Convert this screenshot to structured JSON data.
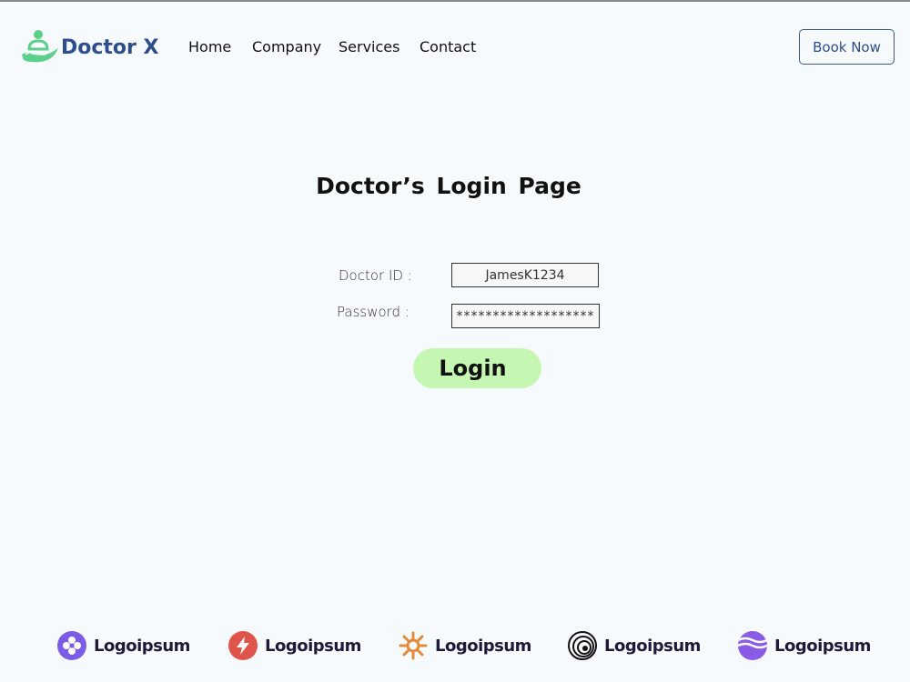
{
  "brand": {
    "name": "Doctor X",
    "color": "#2d4e8a",
    "accent": "#5ccf8a"
  },
  "nav": {
    "items": [
      {
        "label": "Home"
      },
      {
        "label": "Company"
      },
      {
        "label": "Services"
      },
      {
        "label": "Contact"
      }
    ],
    "book_label": "Book Now"
  },
  "page": {
    "title": "Doctor’s  Login Page"
  },
  "form": {
    "doctor_id_label": "Doctor ID :",
    "doctor_id_value": "JamesK1234",
    "password_label": "Password :",
    "password_value": "*******************",
    "login_label": "Login",
    "login_color": "#c5f7b3"
  },
  "partners": [
    {
      "name": "Logoipsum",
      "icon": "flower-icon",
      "color": "#7c5ce6"
    },
    {
      "name": "Logoipsum",
      "icon": "bolt-icon",
      "color": "#e0554b"
    },
    {
      "name": "Logoipsum",
      "icon": "sunburst-icon",
      "color": "#e08a3a"
    },
    {
      "name": "Logoipsum",
      "icon": "spiral-icon",
      "color": "#111111"
    },
    {
      "name": "Logoipsum",
      "icon": "wave-icon",
      "color": "#8a5be6"
    }
  ]
}
